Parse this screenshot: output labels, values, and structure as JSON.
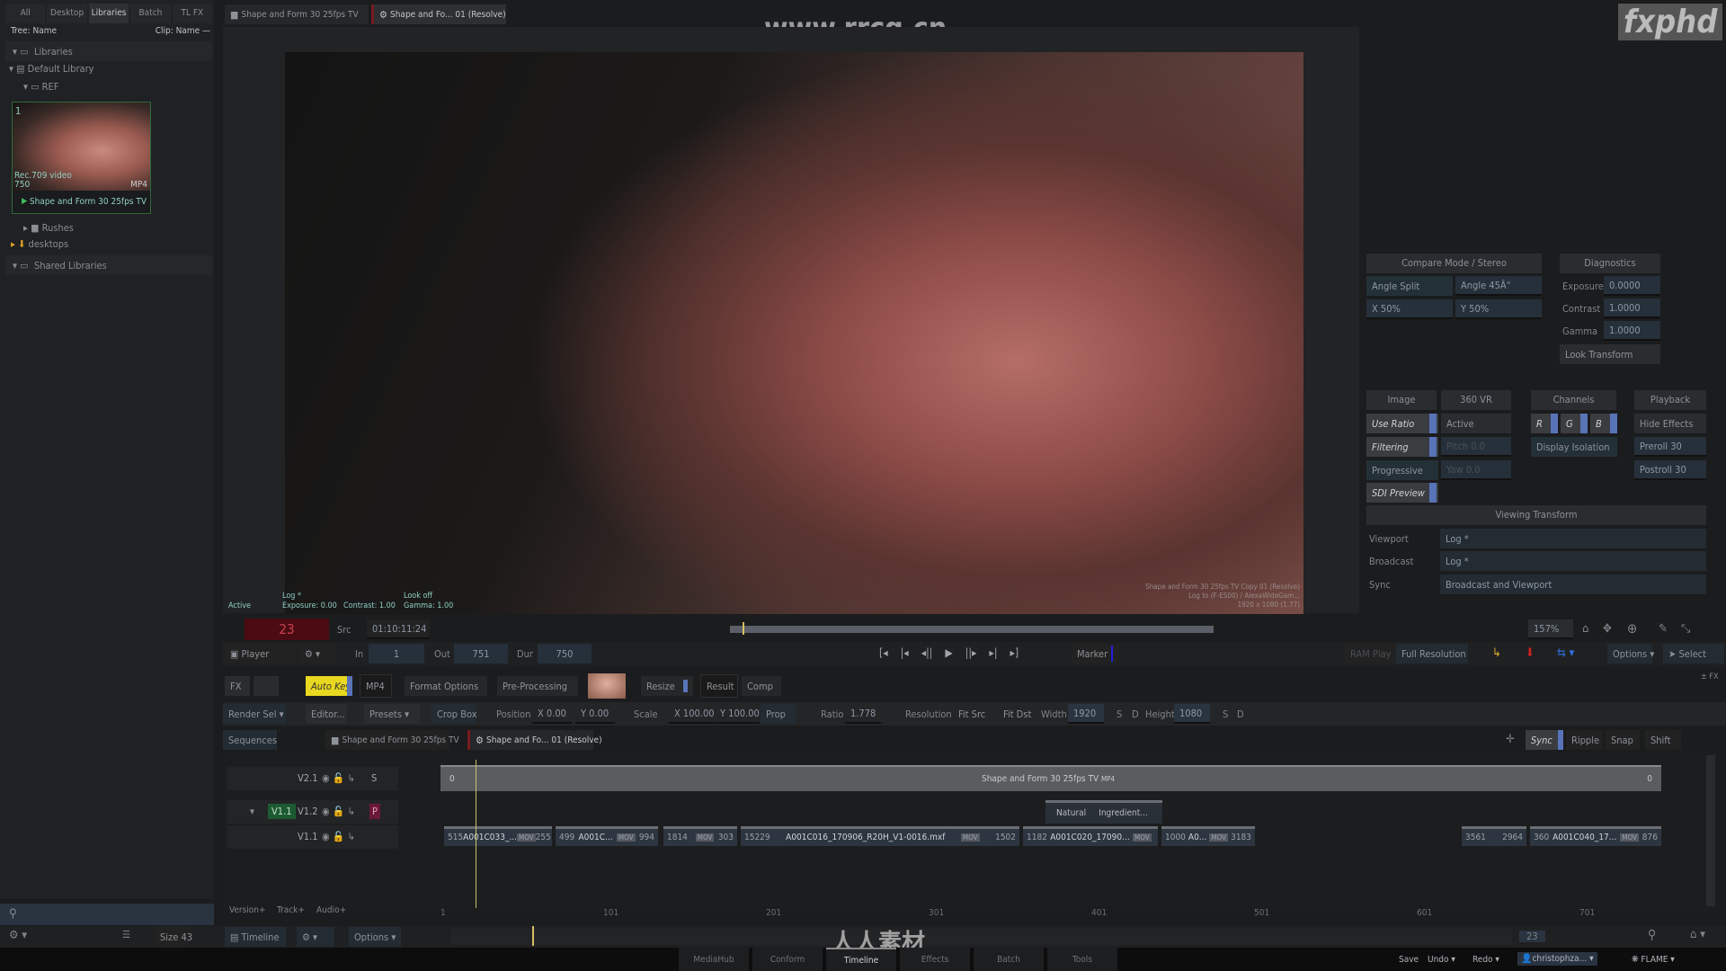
{
  "library_panel": {
    "tabs": [
      "All",
      "Desktop",
      "Libraries",
      "Batch",
      "TL FX"
    ],
    "active_tab": "Libraries",
    "tree_label": "Tree: Name",
    "clip_label": "Clip: Name —",
    "items": {
      "libraries": "Libraries",
      "default_library": "Default Library",
      "ref": "REF",
      "rushes": "Rushes",
      "desktops": "desktops",
      "shared_libraries": "Shared Libraries"
    },
    "thumbnail": {
      "index": "1",
      "colorspace": "Rec.709 video",
      "frames": "750",
      "format": "MP4",
      "name": "Shape and Form 30 25fps TV"
    }
  },
  "viewer_tabs": [
    "Shape and Form 30 25fps TV",
    "Shape and Fo... 01 (Resolve)"
  ],
  "watermark": {
    "site": "www.rrcg.cn",
    "logo": "fxphd",
    "brand": "人人素材"
  },
  "viewer": {
    "overlay_left": {
      "state": "Active",
      "viewport": "Log *",
      "exposure": "Exposure: 0.00",
      "contrast": "Contrast: 1.00",
      "look": "Look off",
      "gamma": "Gamma: 1.00"
    },
    "overlay_right": [
      "Shape and Form 30 25fps TV Copy 01 (Resolve)",
      "Log to (F-ES00) / AlexaWideGam...",
      "1920 x 1080 (1.77)"
    ],
    "frame": "23",
    "src_label": "Src",
    "timecode": "01:10:11:24",
    "zoom": "157%"
  },
  "compare": {
    "header": "Compare Mode / Stereo",
    "angle_split": "Angle Split",
    "angle": "Angle 45Â°",
    "x": "X 50%",
    "y": "Y 50%"
  },
  "diagnostics": {
    "header": "Diagnostics",
    "exposure_label": "Exposure",
    "exposure": "0.0000",
    "contrast_label": "Contrast",
    "contrast": "1.0000",
    "gamma_label": "Gamma",
    "gamma": "1.0000",
    "look_transform": "Look Transform"
  },
  "image": {
    "header": "Image",
    "use_ratio": "Use Ratio",
    "filtering": "Filtering",
    "progressive": "Progressive",
    "sdi_preview": "SDI Preview"
  },
  "vr": {
    "header": "360 VR",
    "active": "Active",
    "pitch": "Pitch 0.0",
    "yaw": "Yaw 0.0"
  },
  "channels": {
    "header": "Channels",
    "r": "R",
    "g": "G",
    "b": "B",
    "display_isolation": "Display Isolation"
  },
  "playback": {
    "header": "Playback",
    "hide_effects": "Hide Effects",
    "preroll": "Preroll 30",
    "postroll": "Postroll 30"
  },
  "viewing_transform": {
    "header": "Viewing Transform",
    "viewport_label": "Viewport",
    "viewport": "Log *",
    "broadcast_label": "Broadcast",
    "broadcast": "Log *",
    "sync_label": "Sync",
    "sync": "Broadcast and Viewport"
  },
  "player_bar": {
    "player": "Player",
    "in_label": "In",
    "in": "1",
    "out_label": "Out",
    "out": "751",
    "dur_label": "Dur",
    "dur": "750",
    "marker": "Marker",
    "ram_play": "RAM Play",
    "full_res": "Full Resolution",
    "options": "Options",
    "select": "Select",
    "fx": "± FX"
  },
  "fx_bar": {
    "fx": "FX",
    "auto_key": "Auto Key",
    "mp4": "MP4",
    "format_options": "Format Options",
    "pre_processing": "Pre-Processing",
    "resize": "Resize",
    "result": "Result",
    "comp": "Comp"
  },
  "resize_bar": {
    "render_sel": "Render Sel",
    "editor": "Editor...",
    "presets": "Presets",
    "crop_box": "Crop Box",
    "position": "Position",
    "pos_x": "X 0.00",
    "pos_y": "Y 0.00",
    "scale": "Scale",
    "scale_x": "X 100.00",
    "scale_y": "Y 100.00",
    "prop": "Prop",
    "ratio_label": "Ratio",
    "ratio": "1.778",
    "resolution": "Resolution",
    "fit_src": "Fit Src",
    "fit_dst": "Fit Dst",
    "width_label": "Width",
    "width": "1920",
    "height_label": "Height",
    "height": "1080",
    "s": "S",
    "d": "D"
  },
  "sequences": {
    "label": "Sequences",
    "tabs": [
      "Shape and Form 30 25fps TV",
      "Shape and Fo... 01 (Resolve)"
    ],
    "sync": "Sync",
    "ripple": "Ripple",
    "snap": "Snap",
    "shift": "Shift"
  },
  "tracks": [
    {
      "name": "V2.1",
      "flag": "S"
    },
    {
      "name": "V1.2",
      "primary": "V1.1",
      "flag": "P"
    },
    {
      "name": "V1.1",
      "flag": ""
    }
  ],
  "v2_clip": {
    "start": "0",
    "name": "Shape and Form 30 25fps TV",
    "format": "MP4",
    "end": "0"
  },
  "transition": {
    "a": "Natural",
    "b": "Ingredient..."
  },
  "clips": [
    {
      "in": "515",
      "name": "A001C033_...",
      "fmt": "MOV",
      "out": "255"
    },
    {
      "in": "499",
      "name": "A001C...",
      "fmt": "MOV",
      "out": "994"
    },
    {
      "in": "1814",
      "name": "",
      "fmt": "MOV",
      "out": "303"
    },
    {
      "in": "15229",
      "name": "A001C016_170906_R20H_V1-0016.mxf",
      "fmt": "MOV",
      "out": "1502"
    },
    {
      "in": "1182",
      "name": "A001C020_17090...",
      "fmt": "MOV",
      "out": ""
    },
    {
      "in": "1000",
      "name": "A0...",
      "fmt": "MOV",
      "out": "3183"
    },
    {
      "in": "3561",
      "name": "",
      "fmt": "",
      "out": "2964"
    },
    {
      "in": "360",
      "name": "A001C040_17...",
      "fmt": "MOV",
      "out": "876"
    }
  ],
  "ruler": [
    "1",
    "101",
    "201",
    "301",
    "401",
    "501",
    "601",
    "701"
  ],
  "timeline_bar": {
    "version": "Version+",
    "track": "Track+",
    "audio": "Audio+",
    "size": "Size 43",
    "timeline": "Timeline",
    "options": "Options",
    "frame": "23"
  },
  "footer": {
    "tabs": [
      "MediaHub",
      "Conform",
      "Timeline",
      "Effects",
      "Batch",
      "Tools"
    ],
    "active": "Timeline",
    "save": "Save",
    "undo": "Undo",
    "redo": "Redo",
    "user": "christophza...",
    "app": "FLAME"
  }
}
